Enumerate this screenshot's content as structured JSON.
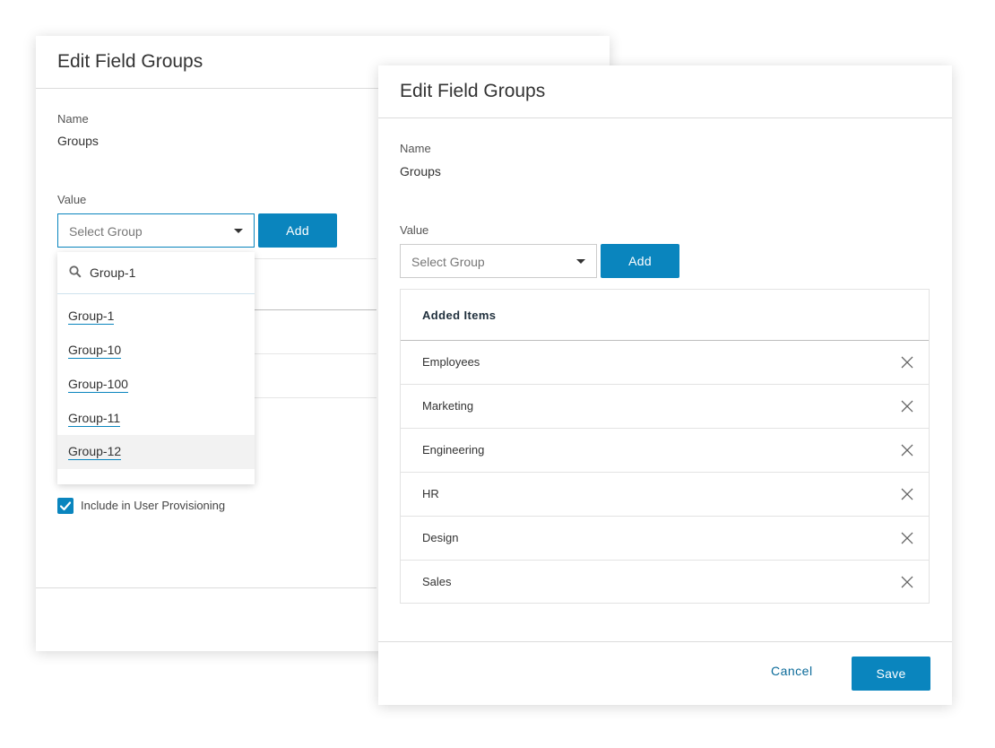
{
  "back_dialog": {
    "title": "Edit Field Groups",
    "name_label": "Name",
    "name_value": "Groups",
    "value_label": "Value",
    "select_placeholder": "Select Group",
    "add_label": "Add",
    "dropdown": {
      "search_value": "Group-1",
      "options": [
        "Group-1",
        "Group-10",
        "Group-100",
        "Group-11",
        "Group-12"
      ],
      "highlighted": "Group-12"
    },
    "checkbox_label": "Include in User Provisioning",
    "checkbox_checked": true
  },
  "front_dialog": {
    "title": "Edit Field Groups",
    "name_label": "Name",
    "name_value": "Groups",
    "value_label": "Value",
    "select_placeholder": "Select Group",
    "add_label": "Add",
    "table_header": "Added Items",
    "items": [
      "Employees",
      "Marketing",
      "Engineering",
      "HR",
      "Design",
      "Sales"
    ],
    "cancel_label": "Cancel",
    "save_label": "Save"
  },
  "colors": {
    "primary": "#0a85be",
    "link": "#0a6a99"
  },
  "icons": {
    "dropdown": "chevron-down-icon",
    "search": "search-icon",
    "remove": "close-icon",
    "check": "check-icon"
  }
}
